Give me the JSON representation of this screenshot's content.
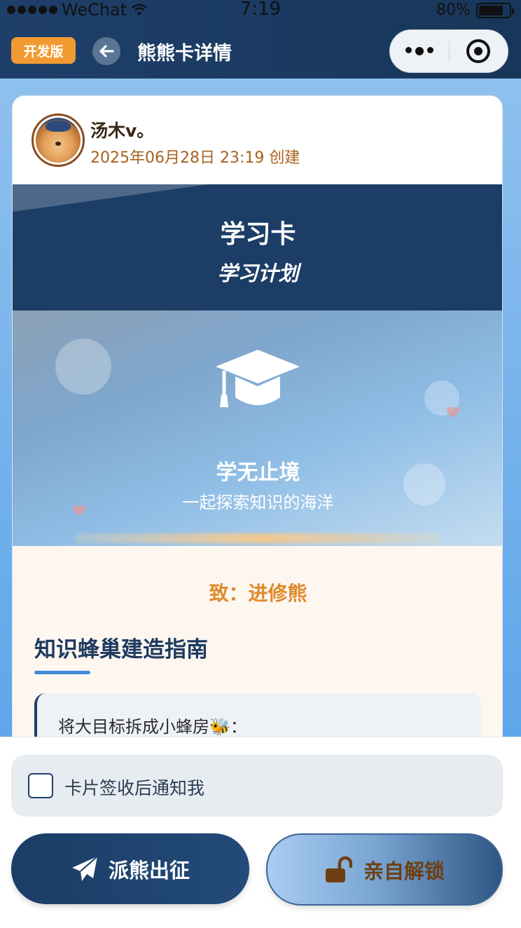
{
  "status_bar": {
    "carrier": "WeChat",
    "time": "7:19",
    "battery": "80%"
  },
  "nav": {
    "dev_badge": "开发版",
    "title": "熊熊卡详情"
  },
  "card": {
    "user_name": "汤木v。",
    "created_at": "2025年06月28日 23:19 创建",
    "banner_title": "学习卡",
    "banner_subtitle": "学习计划",
    "hero_title": "学无止境",
    "hero_subtitle": "一起探索知识的海洋",
    "recipient": "致：进修熊",
    "section_title": "知识蜂巢建造指南",
    "tip_text": "将大目标拆成小蜂房🐝："
  },
  "bottom": {
    "notify_label": "卡片签收后通知我",
    "notify_checked": false,
    "send_button": "派熊出征",
    "unlock_button": "亲自解锁"
  },
  "colors": {
    "nav_bg": "#1e3f6a",
    "dev_badge": "#f29a32",
    "accent_orange": "#e08a2b",
    "title_navy": "#1e3a5f",
    "underline_blue": "#3f8bdc"
  },
  "icons": {
    "back": "arrow-left-icon",
    "more": "more-dots-icon",
    "close": "target-circle-icon",
    "hero": "graduation-cap-icon",
    "send": "paper-plane-icon",
    "unlock": "unlock-icon"
  }
}
